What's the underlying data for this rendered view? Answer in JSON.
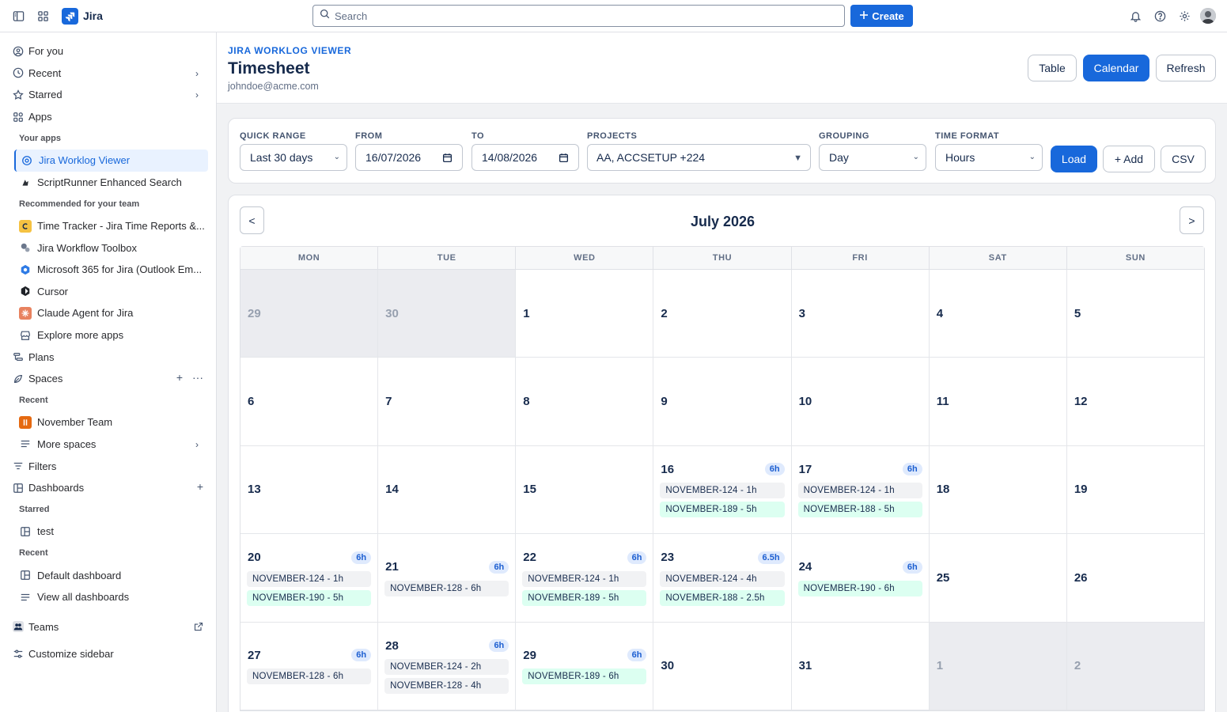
{
  "topbar": {
    "app_name": "Jira",
    "search_placeholder": "Search",
    "create_label": "Create"
  },
  "sidebar": {
    "for_you": "For you",
    "recent": "Recent",
    "starred": "Starred",
    "apps": "Apps",
    "your_apps_label": "Your apps",
    "your_apps": [
      "Jira Worklog Viewer",
      "ScriptRunner Enhanced Search"
    ],
    "recommended_label": "Recommended for your team",
    "recommended": [
      "Time Tracker - Jira Time Reports &...",
      "Jira Workflow Toolbox",
      "Microsoft 365 for Jira (Outlook Em...",
      "Cursor",
      "Claude Agent for Jira",
      "Explore more apps"
    ],
    "plans": "Plans",
    "spaces": "Spaces",
    "spaces_recent_label": "Recent",
    "spaces_recent": [
      "November Team"
    ],
    "more_spaces": "More spaces",
    "filters": "Filters",
    "dashboards": "Dashboards",
    "dash_starred_label": "Starred",
    "dash_starred": [
      "test"
    ],
    "dash_recent_label": "Recent",
    "dash_recent": [
      "Default dashboard",
      "View all dashboards"
    ],
    "teams": "Teams",
    "customize": "Customize sidebar"
  },
  "header": {
    "kicker": "JIRA WORKLOG VIEWER",
    "title": "Timesheet",
    "email": "johndoe@acme.com",
    "views": [
      "Table",
      "Calendar",
      "Refresh"
    ]
  },
  "filters": {
    "quick_range": {
      "label": "QUICK RANGE",
      "value": "Last 30 days"
    },
    "from": {
      "label": "FROM",
      "value": "16/07/2026"
    },
    "to": {
      "label": "TO",
      "value": "14/08/2026"
    },
    "projects": {
      "label": "PROJECTS",
      "value": "AA, ACCSETUP +224"
    },
    "grouping": {
      "label": "GROUPING",
      "value": "Day"
    },
    "time_format": {
      "label": "TIME FORMAT",
      "value": "Hours"
    },
    "load": "Load",
    "add": "+ Add",
    "csv": "CSV"
  },
  "calendar": {
    "month_title": "July 2026",
    "prev": "<",
    "next": ">",
    "weekdays": [
      "MON",
      "TUE",
      "WED",
      "THU",
      "FRI",
      "SAT",
      "SUN"
    ],
    "weeks": [
      [
        {
          "d": "29",
          "out": true
        },
        {
          "d": "30",
          "out": true
        },
        {
          "d": "1"
        },
        {
          "d": "2"
        },
        {
          "d": "3"
        },
        {
          "d": "4"
        },
        {
          "d": "5"
        }
      ],
      [
        {
          "d": "6"
        },
        {
          "d": "7"
        },
        {
          "d": "8"
        },
        {
          "d": "9"
        },
        {
          "d": "10"
        },
        {
          "d": "11"
        },
        {
          "d": "12"
        }
      ],
      [
        {
          "d": "13"
        },
        {
          "d": "14"
        },
        {
          "d": "15"
        },
        {
          "d": "16",
          "total": "6h",
          "entries": [
            {
              "t": "NOVEMBER-124 - 1h",
              "c": "gray"
            },
            {
              "t": "NOVEMBER-189 - 5h",
              "c": "green"
            }
          ]
        },
        {
          "d": "17",
          "total": "6h",
          "entries": [
            {
              "t": "NOVEMBER-124 - 1h",
              "c": "gray"
            },
            {
              "t": "NOVEMBER-188 - 5h",
              "c": "green"
            }
          ]
        },
        {
          "d": "18"
        },
        {
          "d": "19"
        }
      ],
      [
        {
          "d": "20",
          "total": "6h",
          "entries": [
            {
              "t": "NOVEMBER-124 - 1h",
              "c": "gray"
            },
            {
              "t": "NOVEMBER-190 - 5h",
              "c": "green"
            }
          ]
        },
        {
          "d": "21",
          "total": "6h",
          "entries": [
            {
              "t": "NOVEMBER-128 - 6h",
              "c": "gray"
            }
          ]
        },
        {
          "d": "22",
          "total": "6h",
          "entries": [
            {
              "t": "NOVEMBER-124 - 1h",
              "c": "gray"
            },
            {
              "t": "NOVEMBER-189 - 5h",
              "c": "green"
            }
          ]
        },
        {
          "d": "23",
          "total": "6.5h",
          "entries": [
            {
              "t": "NOVEMBER-124 - 4h",
              "c": "gray"
            },
            {
              "t": "NOVEMBER-188 - 2.5h",
              "c": "green"
            }
          ]
        },
        {
          "d": "24",
          "total": "6h",
          "entries": [
            {
              "t": "NOVEMBER-190 - 6h",
              "c": "green"
            }
          ]
        },
        {
          "d": "25"
        },
        {
          "d": "26"
        }
      ],
      [
        {
          "d": "27",
          "total": "6h",
          "entries": [
            {
              "t": "NOVEMBER-128 - 6h",
              "c": "gray"
            }
          ]
        },
        {
          "d": "28",
          "total": "6h",
          "entries": [
            {
              "t": "NOVEMBER-124 - 2h",
              "c": "gray"
            },
            {
              "t": "NOVEMBER-128 - 4h",
              "c": "gray"
            }
          ]
        },
        {
          "d": "29",
          "total": "6h",
          "entries": [
            {
              "t": "NOVEMBER-189 - 6h",
              "c": "green"
            }
          ]
        },
        {
          "d": "30"
        },
        {
          "d": "31"
        },
        {
          "d": "1",
          "out": true
        },
        {
          "d": "2",
          "out": true
        }
      ]
    ]
  },
  "colors": {
    "accent": "#1868db",
    "entry_gray": "#f1f2f4",
    "entry_green": "#dcfff1",
    "total_badge": "#dfeafd"
  }
}
